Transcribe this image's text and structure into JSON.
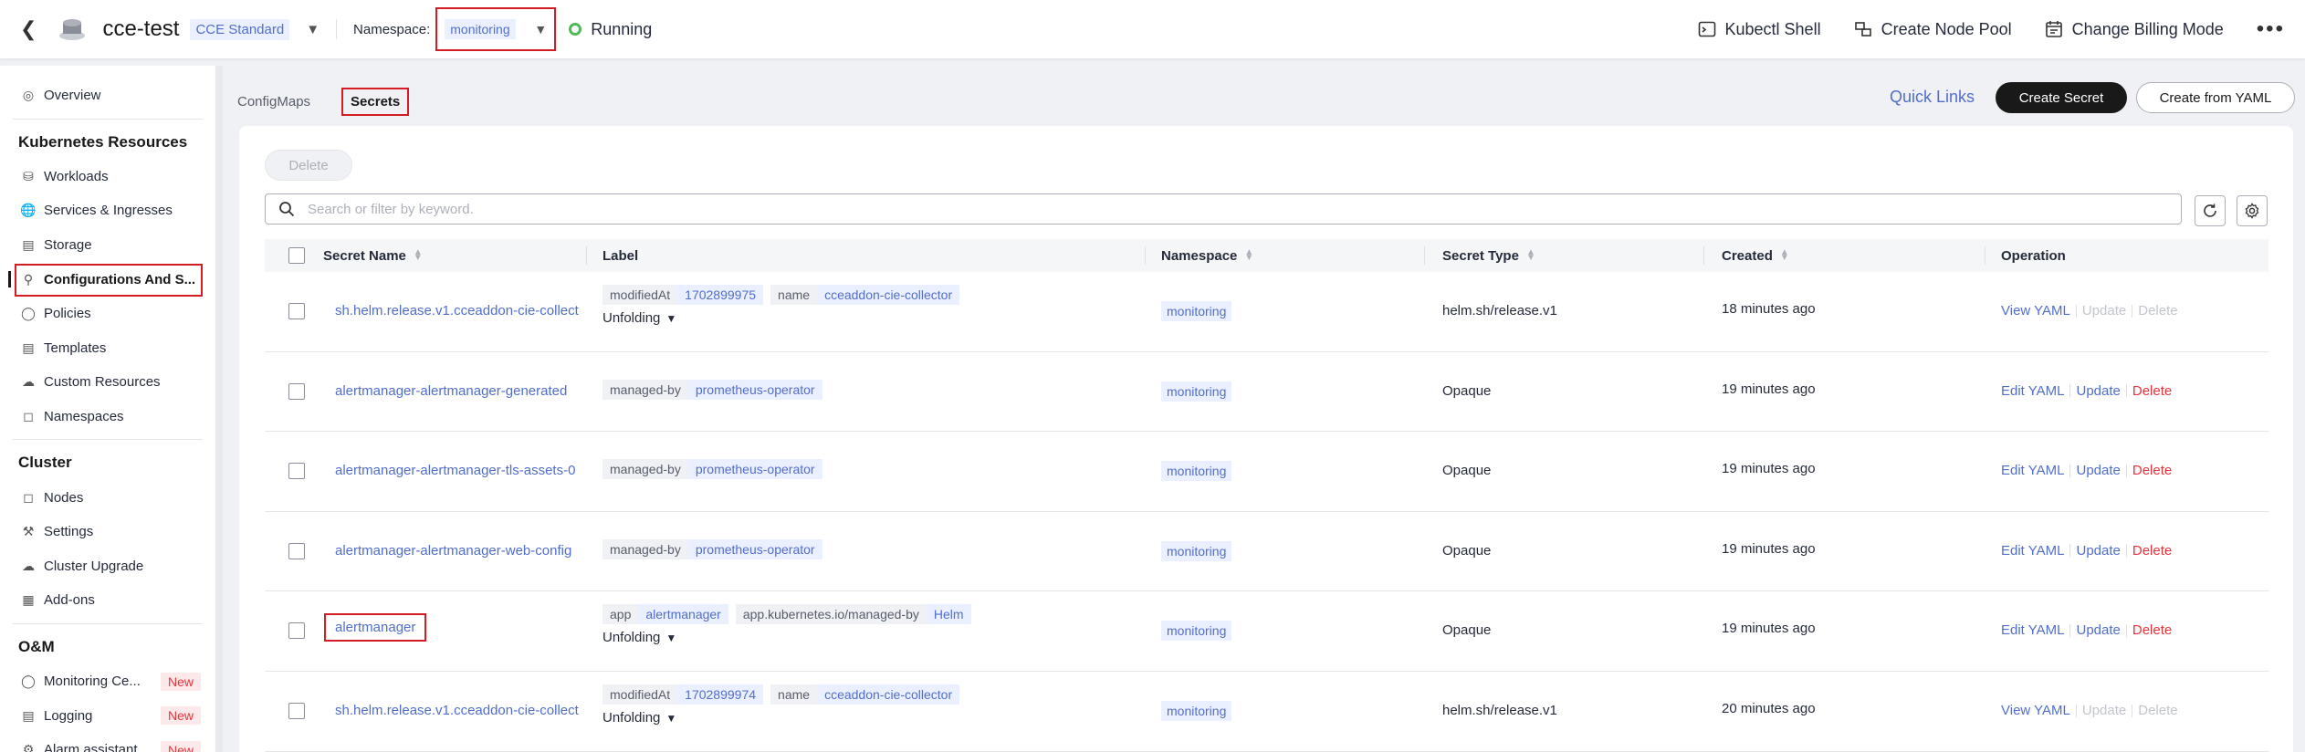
{
  "topbar": {
    "cluster_name": "cce-test",
    "edition": "CCE Standard",
    "namespace_label": "Namespace:",
    "namespace_value": "monitoring",
    "status": "Running",
    "actions": [
      {
        "label": "Kubectl Shell",
        "icon": "terminal-icon"
      },
      {
        "label": "Create Node Pool",
        "icon": "node-pool-icon"
      },
      {
        "label": "Change Billing Mode",
        "icon": "billing-icon"
      }
    ]
  },
  "sidebar": {
    "overview": "Overview",
    "k8s_heading": "Kubernetes Resources",
    "k8s_items": [
      {
        "label": "Workloads",
        "icon": "workloads-icon"
      },
      {
        "label": "Services & Ingresses",
        "icon": "globe-icon"
      },
      {
        "label": "Storage",
        "icon": "storage-icon"
      },
      {
        "label": "Configurations And S...",
        "icon": "key-icon"
      },
      {
        "label": "Policies",
        "icon": "bulb-icon"
      },
      {
        "label": "Templates",
        "icon": "template-icon"
      },
      {
        "label": "Custom Resources",
        "icon": "cloud-icon"
      },
      {
        "label": "Namespaces",
        "icon": "namespace-icon"
      }
    ],
    "cluster_heading": "Cluster",
    "cluster_items": [
      {
        "label": "Nodes",
        "icon": "nodes-icon"
      },
      {
        "label": "Settings",
        "icon": "wrench-icon"
      },
      {
        "label": "Cluster Upgrade",
        "icon": "upgrade-icon"
      },
      {
        "label": "Add-ons",
        "icon": "addons-icon"
      }
    ],
    "om_heading": "O&M",
    "om_items": [
      {
        "label": "Monitoring Ce...",
        "badge": "New",
        "icon": "monitoring-icon"
      },
      {
        "label": "Logging",
        "badge": "New",
        "icon": "logging-icon"
      },
      {
        "label": "Alarm assistant",
        "badge": "New",
        "icon": "alarm-icon"
      }
    ]
  },
  "tabs": [
    "ConfigMaps",
    "Secrets"
  ],
  "quick_links": "Quick Links",
  "create_secret": "Create Secret",
  "create_from_yaml": "Create from YAML",
  "delete_button": "Delete",
  "search_placeholder": "Search or filter by keyword.",
  "columns": [
    "Secret Name",
    "Label",
    "Namespace",
    "Secret Type",
    "Created",
    "Operation"
  ],
  "rows": [
    {
      "name": "sh.helm.release.v1.cceaddon-cie-collect",
      "labels": [
        {
          "k": "modifiedAt",
          "v": "1702899975"
        },
        {
          "k": "name",
          "v": "cceaddon-cie-collector"
        }
      ],
      "unfold": "Unfolding",
      "namespace": "monitoring",
      "type": "helm.sh/release.v1",
      "created": "18 minutes ago",
      "ops": [
        {
          "t": "View YAML",
          "s": "link"
        },
        {
          "t": "Update",
          "s": "disabled"
        },
        {
          "t": "Delete",
          "s": "disabled"
        }
      ]
    },
    {
      "name": "alertmanager-alertmanager-generated",
      "labels": [
        {
          "k": "managed-by",
          "v": "prometheus-operator"
        }
      ],
      "unfold": "",
      "namespace": "monitoring",
      "type": "Opaque",
      "created": "19 minutes ago",
      "ops": [
        {
          "t": "Edit YAML",
          "s": "link"
        },
        {
          "t": "Update",
          "s": "link"
        },
        {
          "t": "Delete",
          "s": "danger"
        }
      ]
    },
    {
      "name": "alertmanager-alertmanager-tls-assets-0",
      "labels": [
        {
          "k": "managed-by",
          "v": "prometheus-operator"
        }
      ],
      "unfold": "",
      "namespace": "monitoring",
      "type": "Opaque",
      "created": "19 minutes ago",
      "ops": [
        {
          "t": "Edit YAML",
          "s": "link"
        },
        {
          "t": "Update",
          "s": "link"
        },
        {
          "t": "Delete",
          "s": "danger"
        }
      ]
    },
    {
      "name": "alertmanager-alertmanager-web-config",
      "labels": [
        {
          "k": "managed-by",
          "v": "prometheus-operator"
        }
      ],
      "unfold": "",
      "namespace": "monitoring",
      "type": "Opaque",
      "created": "19 minutes ago",
      "ops": [
        {
          "t": "Edit YAML",
          "s": "link"
        },
        {
          "t": "Update",
          "s": "link"
        },
        {
          "t": "Delete",
          "s": "danger"
        }
      ]
    },
    {
      "name": "alertmanager",
      "highlight": true,
      "labels": [
        {
          "k": "app",
          "v": "alertmanager"
        },
        {
          "k": "app.kubernetes.io/managed-by",
          "v": "Helm"
        }
      ],
      "unfold": "Unfolding",
      "namespace": "monitoring",
      "type": "Opaque",
      "created": "19 minutes ago",
      "ops": [
        {
          "t": "Edit YAML",
          "s": "link"
        },
        {
          "t": "Update",
          "s": "link"
        },
        {
          "t": "Delete",
          "s": "danger"
        }
      ]
    },
    {
      "name": "sh.helm.release.v1.cceaddon-cie-collect",
      "labels": [
        {
          "k": "modifiedAt",
          "v": "1702899974"
        },
        {
          "k": "name",
          "v": "cceaddon-cie-collector"
        }
      ],
      "unfold": "Unfolding",
      "namespace": "monitoring",
      "type": "helm.sh/release.v1",
      "created": "20 minutes ago",
      "ops": [
        {
          "t": "View YAML",
          "s": "link"
        },
        {
          "t": "Update",
          "s": "disabled"
        },
        {
          "t": "Delete",
          "s": "disabled"
        }
      ]
    }
  ]
}
